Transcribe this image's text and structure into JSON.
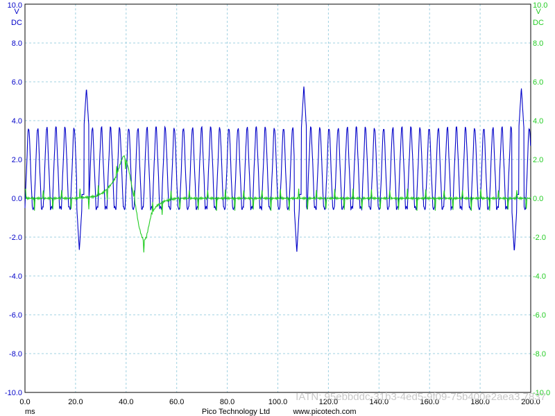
{
  "chart_data": {
    "type": "line",
    "xlim": [
      0,
      200
    ],
    "ylim": [
      -10,
      10
    ],
    "x_ticks": [
      "0.0",
      "20.0",
      "40.0",
      "60.0",
      "80.0",
      "100.0",
      "120.0",
      "140.0",
      "160.0",
      "180.0",
      "200.0"
    ],
    "y_ticks": [
      "10.0",
      "8.0",
      "6.0",
      "4.0",
      "2.0",
      "0.0",
      "-2.0",
      "-4.0",
      "-6.0",
      "-8.0",
      "-10.0"
    ],
    "x_unit": "ms",
    "left_axis": {
      "unit": "V",
      "coupling": "DC",
      "color": "#0000c8"
    },
    "right_axis": {
      "unit": "V",
      "coupling": "DC",
      "color": "#22cc22"
    },
    "grid": true,
    "grid_color": "#9fd0e0",
    "series": [
      {
        "color": "#0000c8",
        "description_values": {
          "oscillation_period_ms": 3.6,
          "oscillation_high_v": 3.6,
          "oscillation_low_v": -0.5,
          "sync_pulses": [
            {
              "low_time_ms": 21.5,
              "low_v": -2.7,
              "high_time_ms": 24.3,
              "high_v": 5.7
            },
            {
              "low_time_ms": 107.5,
              "low_v": -2.8,
              "high_time_ms": 110.3,
              "high_v": 5.8
            },
            {
              "low_time_ms": 193.5,
              "low_v": -2.8,
              "high_time_ms": 196.3,
              "high_v": 5.7
            }
          ]
        }
      },
      {
        "color": "#22cc22",
        "points": [
          [
            0,
            0.0
          ],
          [
            10,
            0.0
          ],
          [
            20,
            0.0
          ],
          [
            28,
            0.1
          ],
          [
            31,
            0.3
          ],
          [
            34,
            0.7
          ],
          [
            36,
            1.1
          ],
          [
            38,
            1.9
          ],
          [
            39,
            2.2
          ],
          [
            40,
            2.0
          ],
          [
            41,
            1.5
          ],
          [
            42,
            0.8
          ],
          [
            43,
            0.1
          ],
          [
            44,
            -0.6
          ],
          [
            45,
            -1.4
          ],
          [
            46,
            -1.9
          ],
          [
            47,
            -2.2
          ],
          [
            48,
            -2.0
          ],
          [
            49,
            -1.4
          ],
          [
            50,
            -0.8
          ],
          [
            52,
            -0.4
          ],
          [
            55,
            -0.15
          ],
          [
            60,
            0.0
          ],
          [
            200,
            0.0
          ]
        ]
      }
    ]
  },
  "footer": {
    "company": "Pico Technology Ltd",
    "website": "www.picotech.com"
  },
  "watermark": "IATN: 95ebbddc-31b3-4ed5-9f09-75b400e2aea3.7837"
}
